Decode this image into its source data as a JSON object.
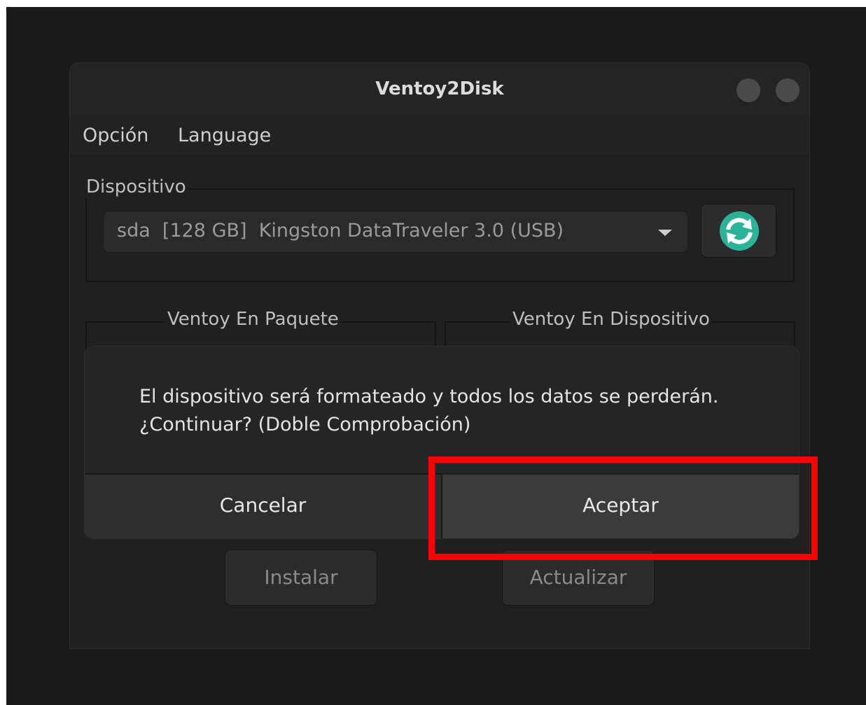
{
  "window": {
    "title": "Ventoy2Disk"
  },
  "menu": {
    "items": [
      {
        "label": "Opción"
      },
      {
        "label": "Language"
      }
    ]
  },
  "device": {
    "group_label": "Dispositivo",
    "selected": "sda  [128 GB]  Kingston DataTraveler 3.0 (USB)",
    "refresh_icon": "refresh-icon"
  },
  "ventoy": {
    "package_label": "Ventoy En Paquete",
    "device_label": "Ventoy En Dispositivo"
  },
  "buttons": {
    "install": "Instalar",
    "update": "Actualizar"
  },
  "dialog": {
    "message_line1": "El dispositivo será formateado y todos los datos se perderán.",
    "message_line2": "¿Continuar? (Doble Comprobación)",
    "cancel": "Cancelar",
    "accept": "Aceptar"
  },
  "colors": {
    "accent": "#2bb39a",
    "highlight": "#ff0000"
  }
}
